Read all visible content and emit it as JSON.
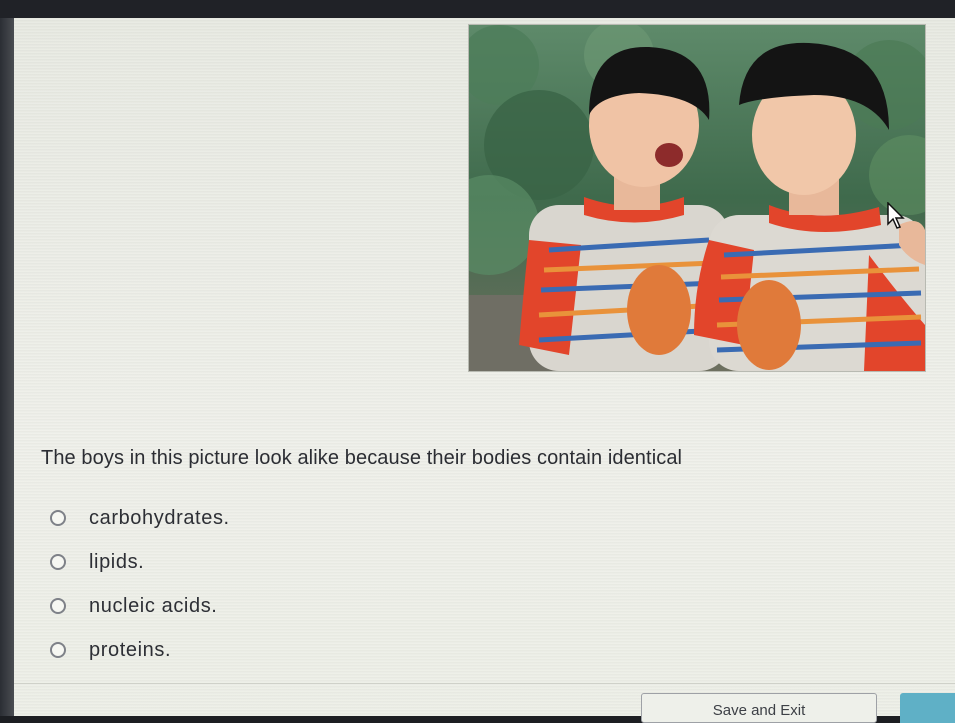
{
  "photo": {
    "alt": "Two boys in matching striped shirts with orange sleeves"
  },
  "question": {
    "text": "The boys in this picture look alike because their bodies contain identical"
  },
  "options": [
    {
      "label": "carbohydrates."
    },
    {
      "label": "lipids."
    },
    {
      "label": "nucleic acids."
    },
    {
      "label": "proteins."
    }
  ],
  "footer": {
    "save_exit_label": "Save and Exit",
    "next_label": ""
  },
  "colors": {
    "accent": "#5fb0c6",
    "page_background": "#eceee6",
    "text": "#2b2d33"
  }
}
